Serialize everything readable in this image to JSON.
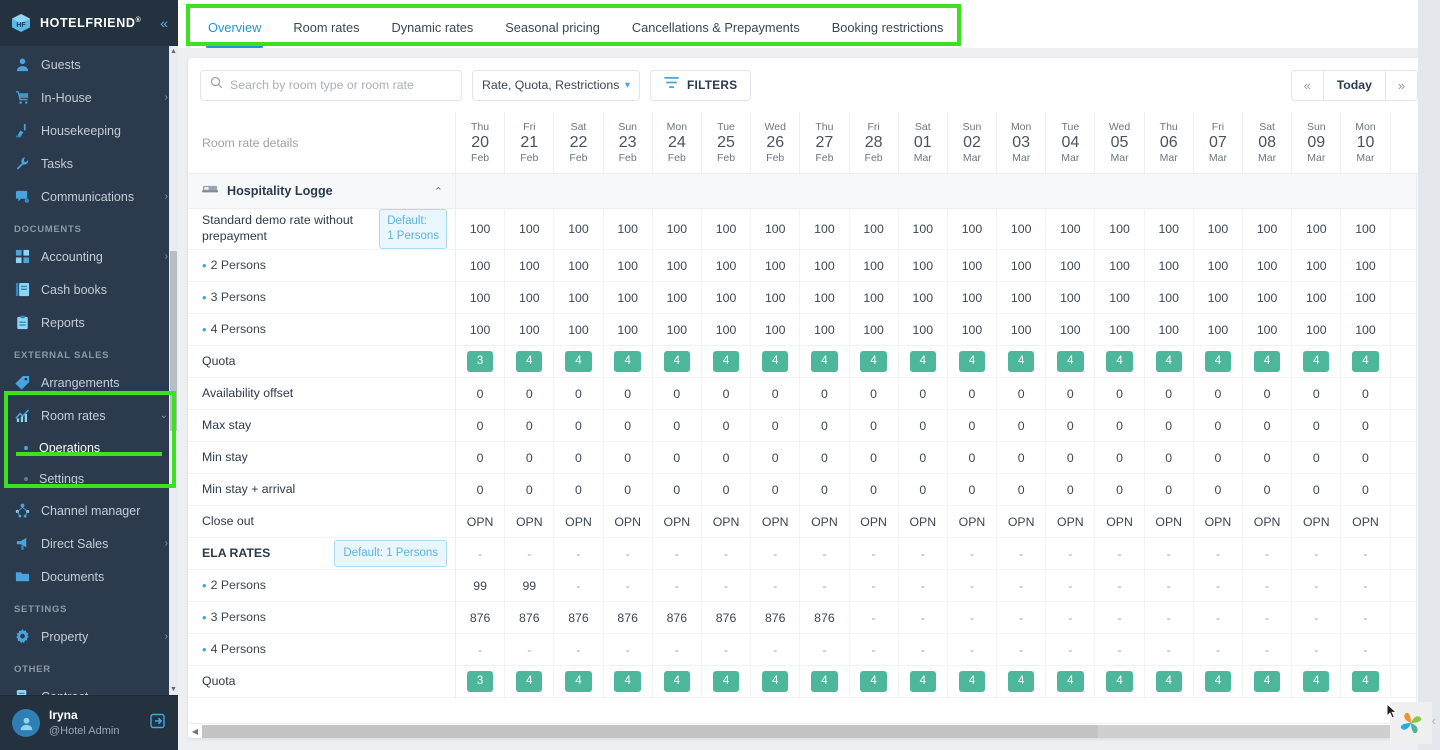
{
  "brand": {
    "name": "HOTELFRIEND",
    "reg": "®"
  },
  "sidebar": {
    "items": [
      {
        "label": "Guests",
        "icon": "user-icon",
        "chevron": ""
      },
      {
        "label": "In-House",
        "icon": "cart-icon",
        "chevron": "›"
      },
      {
        "label": "Housekeeping",
        "icon": "broom-icon",
        "chevron": ""
      },
      {
        "label": "Tasks",
        "icon": "wrench-icon",
        "chevron": ""
      },
      {
        "label": "Communications",
        "icon": "chat-icon",
        "chevron": "›"
      }
    ],
    "section_documents": "DOCUMENTS",
    "documents": [
      {
        "label": "Accounting",
        "icon": "grid-icon",
        "chevron": "›"
      },
      {
        "label": "Cash books",
        "icon": "book-icon",
        "chevron": ""
      },
      {
        "label": "Reports",
        "icon": "clipboard-icon",
        "chevron": ""
      }
    ],
    "section_external": "EXTERNAL SALES",
    "external": [
      {
        "label": "Arrangements",
        "icon": "tag-icon",
        "chevron": ""
      }
    ],
    "room_rates": {
      "label": "Room rates",
      "icon": "chart-icon",
      "chevron": "⌄"
    },
    "room_rates_sub": [
      {
        "label": "Operations",
        "active": true
      },
      {
        "label": "Settings",
        "active": false
      }
    ],
    "external2": [
      {
        "label": "Channel manager",
        "icon": "nodes-icon",
        "chevron": ""
      },
      {
        "label": "Direct Sales",
        "icon": "megaphone-icon",
        "chevron": "›"
      },
      {
        "label": "Documents",
        "icon": "folder-icon",
        "chevron": ""
      }
    ],
    "section_settings": "SETTINGS",
    "settings": [
      {
        "label": "Property",
        "icon": "gear-icon",
        "chevron": "›"
      }
    ],
    "section_other": "OTHER",
    "other": [
      {
        "label": "Contract",
        "icon": "contract-icon",
        "chevron": ""
      }
    ],
    "user": {
      "name": "Iryna",
      "role": "@Hotel Admin"
    }
  },
  "tabs": [
    {
      "label": "Overview",
      "active": true
    },
    {
      "label": "Room rates",
      "active": false
    },
    {
      "label": "Dynamic rates",
      "active": false
    },
    {
      "label": "Seasonal pricing",
      "active": false
    },
    {
      "label": "Cancellations & Prepayments",
      "active": false
    },
    {
      "label": "Booking restrictions",
      "active": false
    }
  ],
  "toolbar": {
    "search_placeholder": "Search by room type or room rate",
    "search_value": "",
    "select_value": "Rate, Quota, Restrictions",
    "filters_label": "FILTERS",
    "prev_label": "«",
    "today_label": "Today",
    "next_label": "»"
  },
  "grid": {
    "label_header": "Room rate details",
    "dates": [
      {
        "dow": "Thu",
        "day": "20",
        "mon": "Feb"
      },
      {
        "dow": "Fri",
        "day": "21",
        "mon": "Feb"
      },
      {
        "dow": "Sat",
        "day": "22",
        "mon": "Feb"
      },
      {
        "dow": "Sun",
        "day": "23",
        "mon": "Feb"
      },
      {
        "dow": "Mon",
        "day": "24",
        "mon": "Feb"
      },
      {
        "dow": "Tue",
        "day": "25",
        "mon": "Feb"
      },
      {
        "dow": "Wed",
        "day": "26",
        "mon": "Feb"
      },
      {
        "dow": "Thu",
        "day": "27",
        "mon": "Feb"
      },
      {
        "dow": "Fri",
        "day": "28",
        "mon": "Feb"
      },
      {
        "dow": "Sat",
        "day": "01",
        "mon": "Mar"
      },
      {
        "dow": "Sun",
        "day": "02",
        "mon": "Mar"
      },
      {
        "dow": "Mon",
        "day": "03",
        "mon": "Mar"
      },
      {
        "dow": "Tue",
        "day": "04",
        "mon": "Mar"
      },
      {
        "dow": "Wed",
        "day": "05",
        "mon": "Mar"
      },
      {
        "dow": "Thu",
        "day": "06",
        "mon": "Mar"
      },
      {
        "dow": "Fri",
        "day": "07",
        "mon": "Mar"
      },
      {
        "dow": "Sat",
        "day": "08",
        "mon": "Mar"
      },
      {
        "dow": "Sun",
        "day": "09",
        "mon": "Mar"
      },
      {
        "dow": "Mon",
        "day": "10",
        "mon": "Mar"
      }
    ],
    "group": {
      "name": "Hospitality Logge",
      "icon": "bed-icon",
      "collapse": "⌃"
    },
    "rows": [
      {
        "label": "Standard demo rate without prepayment",
        "type": "rate",
        "badge": "Default:\n1 Persons",
        "badge_lines": [
          "Default:",
          "1 Persons"
        ],
        "bullet": false,
        "bold": false,
        "values": [
          "100",
          "100",
          "100",
          "100",
          "100",
          "100",
          "100",
          "100",
          "100",
          "100",
          "100",
          "100",
          "100",
          "100",
          "100",
          "100",
          "100",
          "100",
          "100"
        ]
      },
      {
        "label": "2 Persons",
        "type": "rate",
        "bullet": true,
        "bold": false,
        "values": [
          "100",
          "100",
          "100",
          "100",
          "100",
          "100",
          "100",
          "100",
          "100",
          "100",
          "100",
          "100",
          "100",
          "100",
          "100",
          "100",
          "100",
          "100",
          "100"
        ]
      },
      {
        "label": "3 Persons",
        "type": "rate",
        "bullet": true,
        "bold": false,
        "values": [
          "100",
          "100",
          "100",
          "100",
          "100",
          "100",
          "100",
          "100",
          "100",
          "100",
          "100",
          "100",
          "100",
          "100",
          "100",
          "100",
          "100",
          "100",
          "100"
        ]
      },
      {
        "label": "4 Persons",
        "type": "rate",
        "bullet": true,
        "bold": false,
        "values": [
          "100",
          "100",
          "100",
          "100",
          "100",
          "100",
          "100",
          "100",
          "100",
          "100",
          "100",
          "100",
          "100",
          "100",
          "100",
          "100",
          "100",
          "100",
          "100"
        ]
      },
      {
        "label": "Quota",
        "type": "pill",
        "bullet": false,
        "bold": false,
        "values": [
          "3",
          "4",
          "4",
          "4",
          "4",
          "4",
          "4",
          "4",
          "4",
          "4",
          "4",
          "4",
          "4",
          "4",
          "4",
          "4",
          "4",
          "4",
          "4"
        ]
      },
      {
        "label": "Availability offset",
        "type": "num",
        "bullet": false,
        "bold": false,
        "values": [
          "0",
          "0",
          "0",
          "0",
          "0",
          "0",
          "0",
          "0",
          "0",
          "0",
          "0",
          "0",
          "0",
          "0",
          "0",
          "0",
          "0",
          "0",
          "0"
        ]
      },
      {
        "label": "Max stay",
        "type": "num",
        "bullet": false,
        "bold": false,
        "values": [
          "0",
          "0",
          "0",
          "0",
          "0",
          "0",
          "0",
          "0",
          "0",
          "0",
          "0",
          "0",
          "0",
          "0",
          "0",
          "0",
          "0",
          "0",
          "0"
        ]
      },
      {
        "label": "Min stay",
        "type": "num",
        "bullet": false,
        "bold": false,
        "values": [
          "0",
          "0",
          "0",
          "0",
          "0",
          "0",
          "0",
          "0",
          "0",
          "0",
          "0",
          "0",
          "0",
          "0",
          "0",
          "0",
          "0",
          "0",
          "0"
        ]
      },
      {
        "label": "Min stay + arrival",
        "type": "num",
        "bullet": false,
        "bold": false,
        "values": [
          "0",
          "0",
          "0",
          "0",
          "0",
          "0",
          "0",
          "0",
          "0",
          "0",
          "0",
          "0",
          "0",
          "0",
          "0",
          "0",
          "0",
          "0",
          "0"
        ]
      },
      {
        "label": "Close out",
        "type": "num",
        "bullet": false,
        "bold": false,
        "values": [
          "OPN",
          "OPN",
          "OPN",
          "OPN",
          "OPN",
          "OPN",
          "OPN",
          "OPN",
          "OPN",
          "OPN",
          "OPN",
          "OPN",
          "OPN",
          "OPN",
          "OPN",
          "OPN",
          "OPN",
          "OPN",
          "OPN"
        ]
      },
      {
        "label": "ELA RATES",
        "type": "rate",
        "badge_lines": [
          "Default: 1 Persons"
        ],
        "bullet": false,
        "bold": true,
        "values": [
          "-",
          "-",
          "-",
          "-",
          "-",
          "-",
          "-",
          "-",
          "-",
          "-",
          "-",
          "-",
          "-",
          "-",
          "-",
          "-",
          "-",
          "-",
          "-"
        ]
      },
      {
        "label": "2 Persons",
        "type": "rate",
        "bullet": true,
        "bold": false,
        "values": [
          "99",
          "99",
          "-",
          "-",
          "-",
          "-",
          "-",
          "-",
          "-",
          "-",
          "-",
          "-",
          "-",
          "-",
          "-",
          "-",
          "-",
          "-",
          "-"
        ]
      },
      {
        "label": "3 Persons",
        "type": "rate",
        "bullet": true,
        "bold": false,
        "values": [
          "876",
          "876",
          "876",
          "876",
          "876",
          "876",
          "876",
          "876",
          "-",
          "-",
          "-",
          "-",
          "-",
          "-",
          "-",
          "-",
          "-",
          "-",
          "-"
        ]
      },
      {
        "label": "4 Persons",
        "type": "rate",
        "bullet": true,
        "bold": false,
        "values": [
          "-",
          "-",
          "-",
          "-",
          "-",
          "-",
          "-",
          "-",
          "-",
          "-",
          "-",
          "-",
          "-",
          "-",
          "-",
          "-",
          "-",
          "-",
          "-"
        ]
      },
      {
        "label": "Quota",
        "type": "pill",
        "bullet": false,
        "bold": false,
        "values": [
          "3",
          "4",
          "4",
          "4",
          "4",
          "4",
          "4",
          "4",
          "4",
          "4",
          "4",
          "4",
          "4",
          "4",
          "4",
          "4",
          "4",
          "4",
          "4"
        ]
      }
    ]
  }
}
